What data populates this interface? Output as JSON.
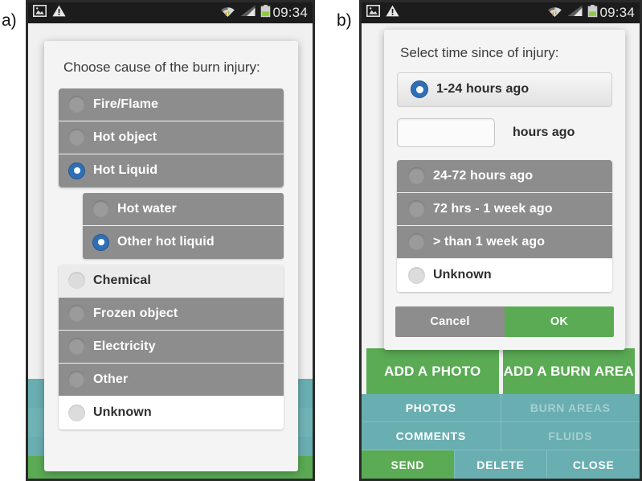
{
  "figure": {
    "panel_a_label": "a)",
    "panel_b_label": "b)"
  },
  "statusbar": {
    "clock": "09:34",
    "icons": [
      "image-icon",
      "warning-icon",
      "wifi-icon",
      "cellular-signal-icon",
      "battery-icon"
    ]
  },
  "panel_a": {
    "dialog": {
      "title": "Choose cause of the burn injury:",
      "groups": [
        {
          "items": [
            {
              "label": "Fire/Flame",
              "style": "gray",
              "selected": false
            },
            {
              "label": "Hot object",
              "style": "gray",
              "selected": false
            },
            {
              "label": "Hot Liquid",
              "style": "gray",
              "selected": true
            }
          ]
        },
        {
          "indented": true,
          "items": [
            {
              "label": "Hot water",
              "style": "gray",
              "selected": false
            },
            {
              "label": "Other hot liquid",
              "style": "gray",
              "selected": true
            }
          ]
        },
        {
          "items": [
            {
              "label": "Chemical",
              "style": "light",
              "selected": false
            },
            {
              "label": "Frozen object",
              "style": "gray",
              "selected": false
            },
            {
              "label": "Electricity",
              "style": "gray",
              "selected": false
            },
            {
              "label": "Other",
              "style": "gray",
              "selected": false
            },
            {
              "label": "Unknown",
              "style": "white",
              "selected": false
            }
          ]
        }
      ]
    }
  },
  "panel_b": {
    "dialog": {
      "title": "Select time since of injury:",
      "selected_option": {
        "label": "1-24 hours ago",
        "selected": true
      },
      "hours_input": {
        "value": "",
        "placeholder": ""
      },
      "hours_suffix": "hours ago",
      "options": [
        {
          "label": "24-72 hours ago",
          "style": "gray",
          "selected": false
        },
        {
          "label": "72 hrs - 1 week ago",
          "style": "gray",
          "selected": false
        },
        {
          "label": "> than 1 week ago",
          "style": "gray",
          "selected": false
        },
        {
          "label": "Unknown",
          "style": "white",
          "selected": false
        }
      ],
      "cancel_label": "Cancel",
      "ok_label": "OK"
    },
    "background_app": {
      "green_buttons": [
        {
          "line1": "ADD A",
          "line2": "PHOTO"
        },
        {
          "line1": "ADD A BURN",
          "line2": "AREA"
        }
      ],
      "tabs": [
        {
          "label": "PHOTOS",
          "state": "active"
        },
        {
          "label": "BURN AREAS",
          "state": "dim"
        },
        {
          "label": "COMMENTS",
          "state": "active"
        },
        {
          "label": "FLUIDS",
          "state": "dim"
        }
      ],
      "actions": [
        {
          "label": "SEND",
          "style": "green"
        },
        {
          "label": "DELETE",
          "style": "teal"
        },
        {
          "label": "CLOSE",
          "style": "teal"
        }
      ]
    }
  },
  "colors": {
    "status_bar": "#1c1c1c",
    "option_gray": "#8d8d8d",
    "radio_selected_blue": "#2f6fb5",
    "accent_green": "#5aab54",
    "tab_teal": "#69aeb1",
    "dialog_bg": "#f4f4f4"
  }
}
